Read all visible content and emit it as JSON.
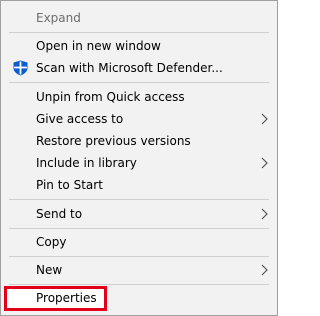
{
  "menu": {
    "items": [
      {
        "label": "Expand",
        "disabled": true
      },
      {
        "label": "Open in new window"
      },
      {
        "label": "Scan with Microsoft Defender...",
        "icon": "defender-shield-icon"
      },
      {
        "label": "Unpin from Quick access"
      },
      {
        "label": "Give access to",
        "submenu": true
      },
      {
        "label": "Restore previous versions"
      },
      {
        "label": "Include in library",
        "submenu": true
      },
      {
        "label": "Pin to Start"
      },
      {
        "label": "Send to",
        "submenu": true
      },
      {
        "label": "Copy"
      },
      {
        "label": "New",
        "submenu": true
      },
      {
        "label": "Properties",
        "highlighted": true
      }
    ]
  },
  "colors": {
    "menu_background": "#f2f2f2",
    "highlight_border": "#e3001b",
    "defender_blue": "#0a5fcf"
  }
}
